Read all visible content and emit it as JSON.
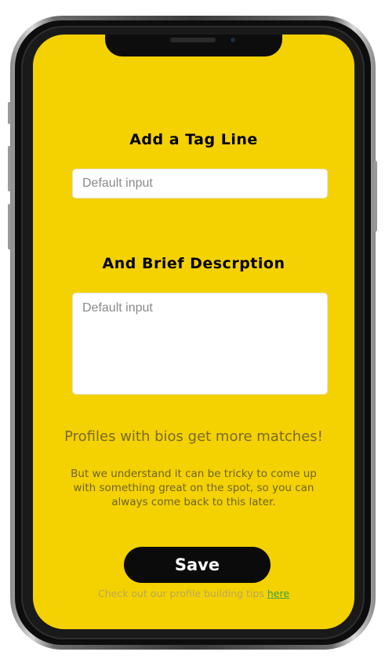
{
  "form": {
    "tagline_heading": "Add a Tag Line",
    "tagline_placeholder": "Default input",
    "description_heading": "And Brief Descrption",
    "description_placeholder": "Default input"
  },
  "messages": {
    "promo": "Profiles with bios get more matches!",
    "note": "But we understand it can be tricky to come up with something great on the spot, so you can always come back to this later."
  },
  "actions": {
    "save_label": "Save",
    "tips_text": "Check out our profile building tips ",
    "tips_link": "here"
  },
  "colors": {
    "screen_background": "#f4d100",
    "button_background": "#0b0b0b",
    "link": "#3f9f4a"
  }
}
